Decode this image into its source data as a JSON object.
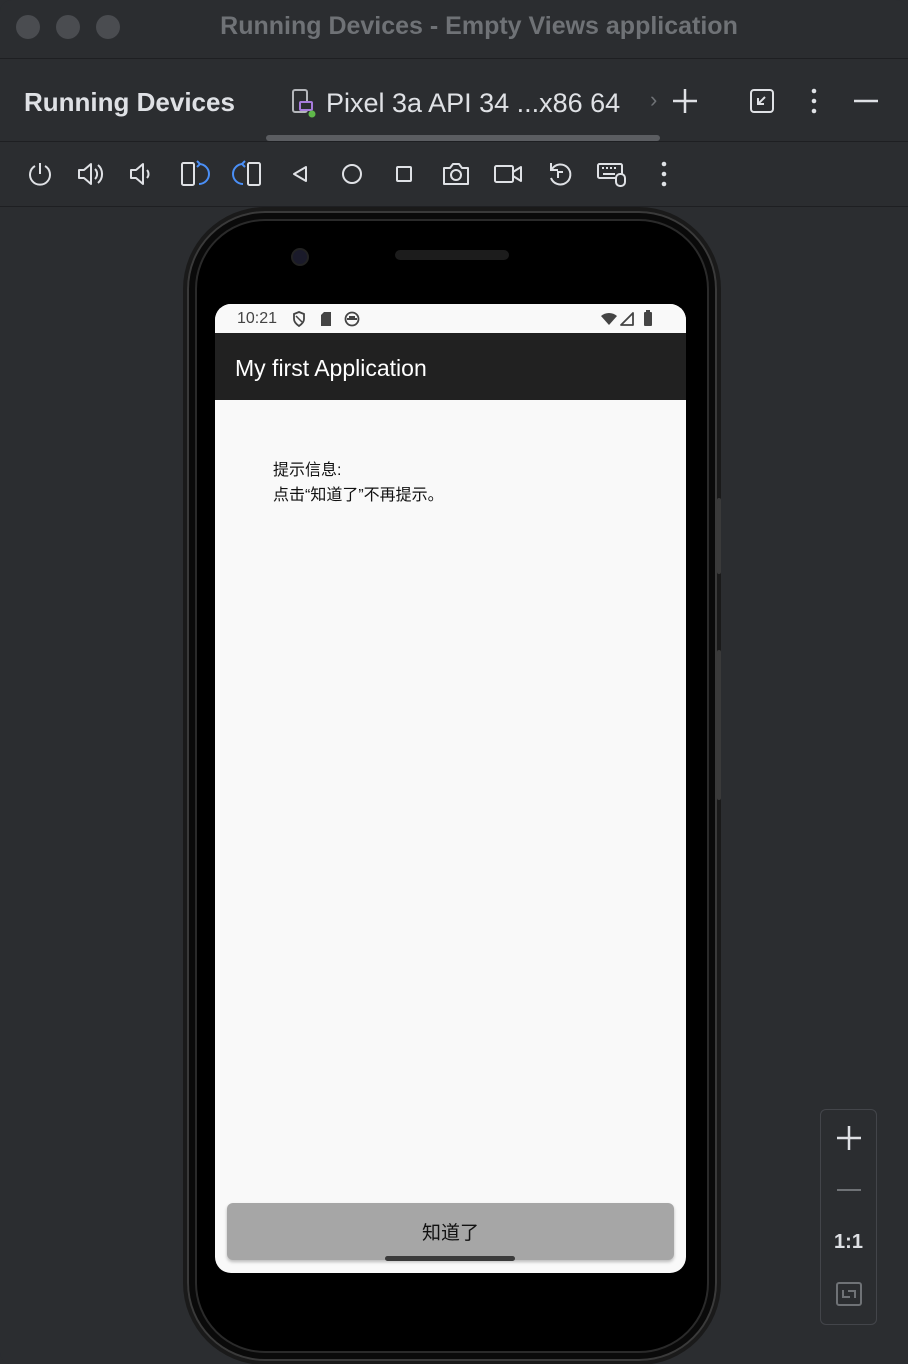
{
  "window": {
    "title": "Running Devices - Empty Views application"
  },
  "header": {
    "title": "Running Devices",
    "device_tab": "Pixel 3a API 34 ...x86 64",
    "overflow_chevron": "›",
    "icons": [
      "add-icon",
      "restore-icon",
      "more-vertical-icon",
      "minimize-icon"
    ]
  },
  "toolbar": {
    "icons": [
      "power-icon",
      "volume-up-icon",
      "volume-down-icon",
      "rotate-left-icon",
      "rotate-right-icon",
      "back-icon",
      "home-icon",
      "overview-icon",
      "screenshot-icon",
      "screen-record-icon",
      "reset-icon",
      "keyboard-mouse-icon",
      "more-vertical-icon"
    ]
  },
  "device": {
    "status_time": "10:21",
    "app_title": "My first Application",
    "message_line1": "提示信息:",
    "message_line2": "点击“知道了”不再提示。",
    "button_label": "知道了"
  },
  "zoom": {
    "ratio_label": "1:1"
  },
  "colors": {
    "ide_background": "#2b2d30",
    "app_bar": "#212121",
    "screen_background": "#f9f9f9",
    "button": "#a6a6a6",
    "running_indicator": "#5fb84a"
  }
}
